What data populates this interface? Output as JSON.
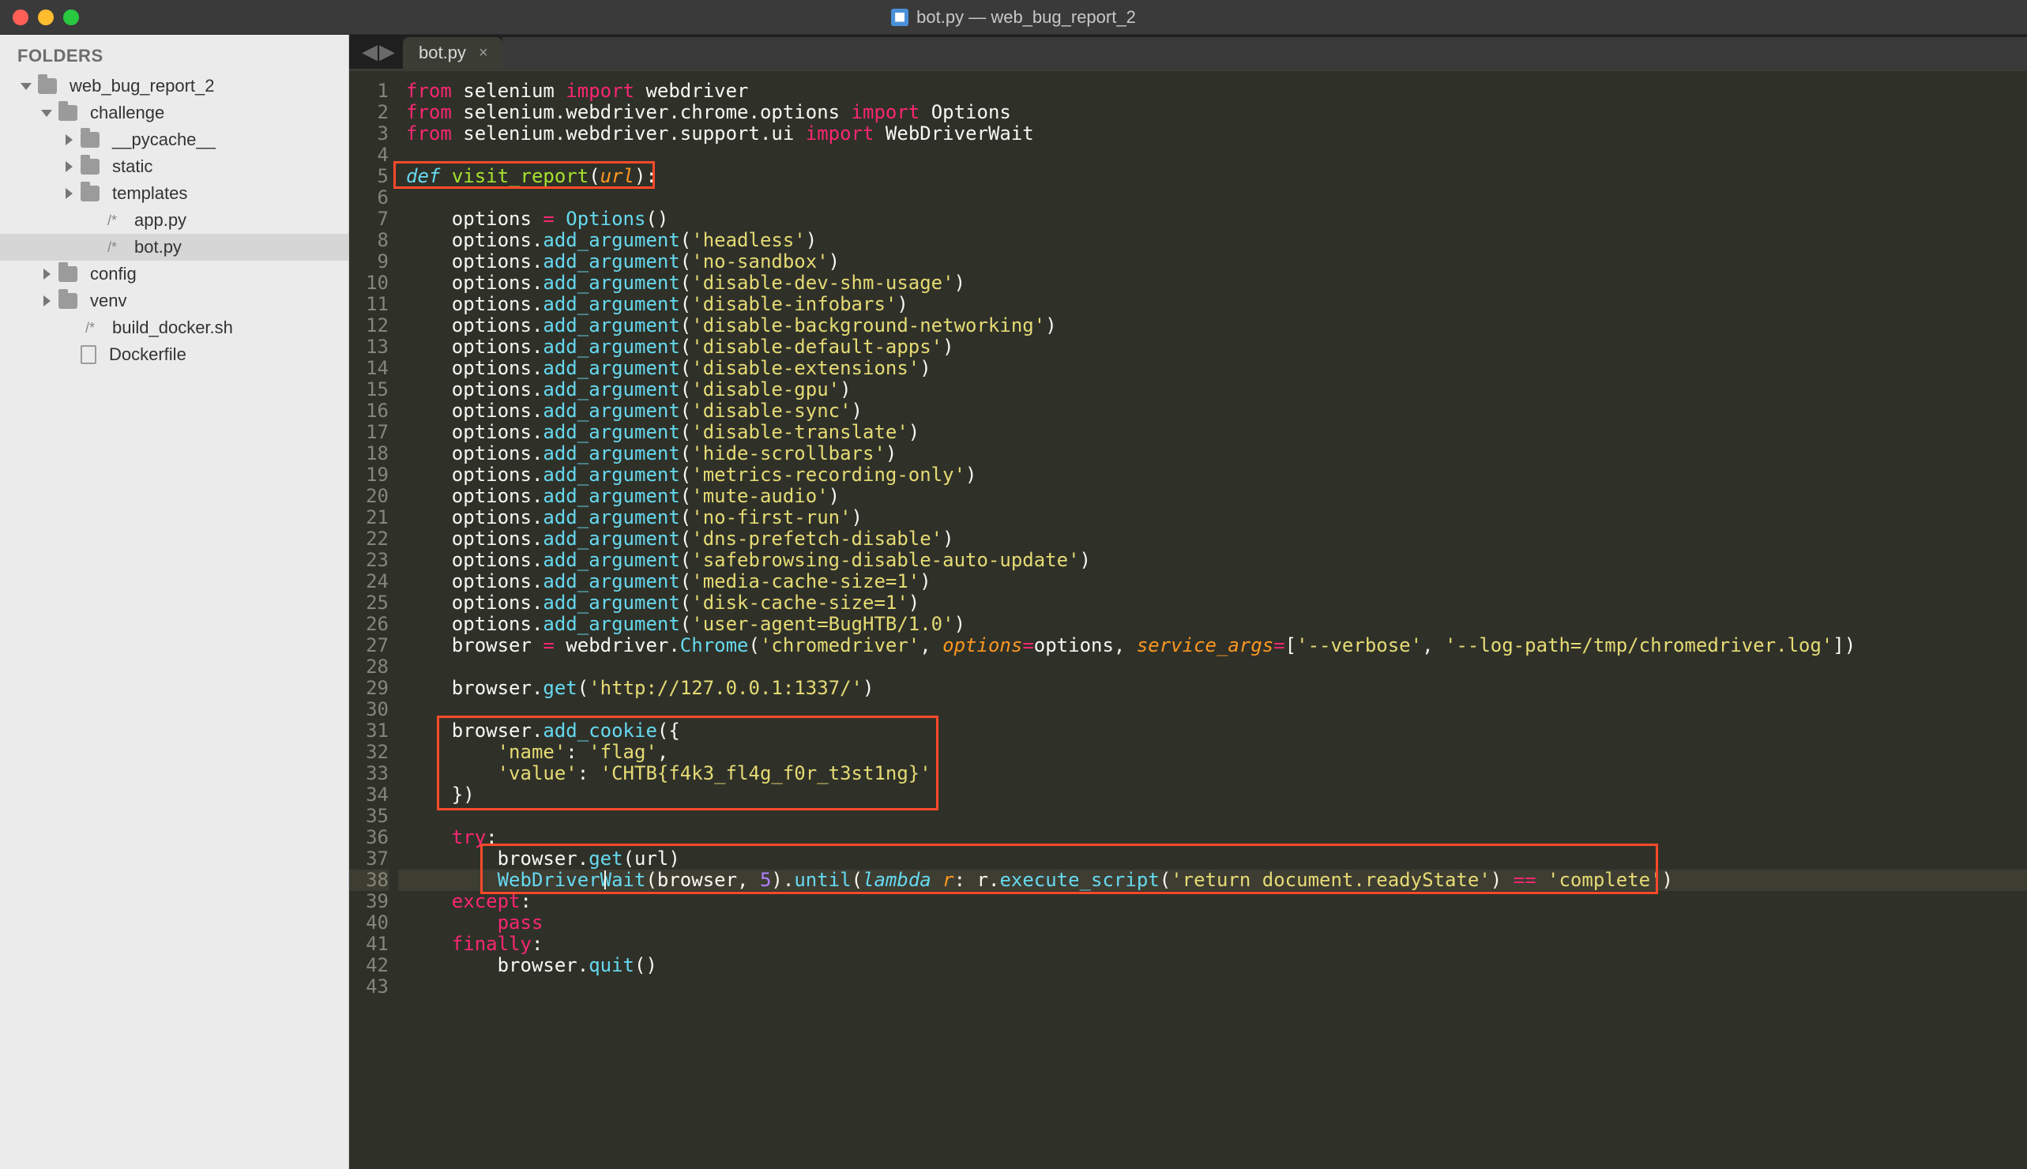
{
  "titlebar": {
    "title": "bot.py — web_bug_report_2"
  },
  "sidebar": {
    "header": "FOLDERS",
    "tree": [
      {
        "indent": 0,
        "arrow": "down",
        "icon": "folder",
        "label": "web_bug_report_2"
      },
      {
        "indent": 1,
        "arrow": "down",
        "icon": "folder",
        "label": "challenge"
      },
      {
        "indent": 2,
        "arrow": "right",
        "icon": "folder",
        "label": "__pycache__"
      },
      {
        "indent": 2,
        "arrow": "right",
        "icon": "folder",
        "label": "static"
      },
      {
        "indent": 2,
        "arrow": "right",
        "icon": "folder",
        "label": "templates"
      },
      {
        "indent": 3,
        "arrow": "",
        "icon": "text",
        "label": "app.py",
        "glyph": "/*"
      },
      {
        "indent": 3,
        "arrow": "",
        "icon": "text",
        "label": "bot.py",
        "glyph": "/*",
        "active": true
      },
      {
        "indent": 1,
        "arrow": "right",
        "icon": "folder",
        "label": "config"
      },
      {
        "indent": 1,
        "arrow": "right",
        "icon": "folder",
        "label": "venv"
      },
      {
        "indent": 2,
        "arrow": "",
        "icon": "text",
        "label": "build_docker.sh",
        "glyph": "/*"
      },
      {
        "indent": 2,
        "arrow": "",
        "icon": "file",
        "label": "Dockerfile"
      }
    ]
  },
  "tabs": {
    "active": {
      "label": "bot.py"
    }
  },
  "editor": {
    "filename": "bot.py",
    "cursor_line": 38,
    "highlight_boxes": [
      {
        "name": "def-visit-report",
        "lines": [
          5,
          5
        ]
      },
      {
        "name": "add-cookie",
        "lines": [
          31,
          34
        ]
      },
      {
        "name": "get-and-wait",
        "lines": [
          37,
          38
        ]
      }
    ],
    "lines": [
      {
        "n": 1,
        "t": [
          [
            "kw",
            "from"
          ],
          [
            "plain",
            " selenium "
          ],
          [
            "kw",
            "import"
          ],
          [
            "plain",
            " webdriver"
          ]
        ]
      },
      {
        "n": 2,
        "t": [
          [
            "kw",
            "from"
          ],
          [
            "plain",
            " selenium"
          ],
          [
            "punc",
            "."
          ],
          [
            "plain",
            "webdriver"
          ],
          [
            "punc",
            "."
          ],
          [
            "plain",
            "chrome"
          ],
          [
            "punc",
            "."
          ],
          [
            "plain",
            "options "
          ],
          [
            "kw",
            "import"
          ],
          [
            "plain",
            " Options"
          ]
        ]
      },
      {
        "n": 3,
        "t": [
          [
            "kw",
            "from"
          ],
          [
            "plain",
            " selenium"
          ],
          [
            "punc",
            "."
          ],
          [
            "plain",
            "webdriver"
          ],
          [
            "punc",
            "."
          ],
          [
            "plain",
            "support"
          ],
          [
            "punc",
            "."
          ],
          [
            "plain",
            "ui "
          ],
          [
            "kw",
            "import"
          ],
          [
            "plain",
            " WebDriverWait"
          ]
        ]
      },
      {
        "n": 4,
        "t": []
      },
      {
        "n": 5,
        "t": [
          [
            "kw2",
            "def"
          ],
          [
            "plain",
            " "
          ],
          [
            "name",
            "visit_report"
          ],
          [
            "punc",
            "("
          ],
          [
            "param",
            "url"
          ],
          [
            "punc",
            "):"
          ]
        ]
      },
      {
        "n": 6,
        "t": []
      },
      {
        "n": 7,
        "t": [
          [
            "plain",
            "    options "
          ],
          [
            "op",
            "="
          ],
          [
            "plain",
            " "
          ],
          [
            "fn",
            "Options"
          ],
          [
            "punc",
            "()"
          ]
        ]
      },
      {
        "n": 8,
        "t": [
          [
            "plain",
            "    options"
          ],
          [
            "punc",
            "."
          ],
          [
            "fn",
            "add_argument"
          ],
          [
            "punc",
            "("
          ],
          [
            "str",
            "'headless'"
          ],
          [
            "punc",
            ")"
          ]
        ]
      },
      {
        "n": 9,
        "t": [
          [
            "plain",
            "    options"
          ],
          [
            "punc",
            "."
          ],
          [
            "fn",
            "add_argument"
          ],
          [
            "punc",
            "("
          ],
          [
            "str",
            "'no-sandbox'"
          ],
          [
            "punc",
            ")"
          ]
        ]
      },
      {
        "n": 10,
        "t": [
          [
            "plain",
            "    options"
          ],
          [
            "punc",
            "."
          ],
          [
            "fn",
            "add_argument"
          ],
          [
            "punc",
            "("
          ],
          [
            "str",
            "'disable-dev-shm-usage'"
          ],
          [
            "punc",
            ")"
          ]
        ]
      },
      {
        "n": 11,
        "t": [
          [
            "plain",
            "    options"
          ],
          [
            "punc",
            "."
          ],
          [
            "fn",
            "add_argument"
          ],
          [
            "punc",
            "("
          ],
          [
            "str",
            "'disable-infobars'"
          ],
          [
            "punc",
            ")"
          ]
        ]
      },
      {
        "n": 12,
        "t": [
          [
            "plain",
            "    options"
          ],
          [
            "punc",
            "."
          ],
          [
            "fn",
            "add_argument"
          ],
          [
            "punc",
            "("
          ],
          [
            "str",
            "'disable-background-networking'"
          ],
          [
            "punc",
            ")"
          ]
        ]
      },
      {
        "n": 13,
        "t": [
          [
            "plain",
            "    options"
          ],
          [
            "punc",
            "."
          ],
          [
            "fn",
            "add_argument"
          ],
          [
            "punc",
            "("
          ],
          [
            "str",
            "'disable-default-apps'"
          ],
          [
            "punc",
            ")"
          ]
        ]
      },
      {
        "n": 14,
        "t": [
          [
            "plain",
            "    options"
          ],
          [
            "punc",
            "."
          ],
          [
            "fn",
            "add_argument"
          ],
          [
            "punc",
            "("
          ],
          [
            "str",
            "'disable-extensions'"
          ],
          [
            "punc",
            ")"
          ]
        ]
      },
      {
        "n": 15,
        "t": [
          [
            "plain",
            "    options"
          ],
          [
            "punc",
            "."
          ],
          [
            "fn",
            "add_argument"
          ],
          [
            "punc",
            "("
          ],
          [
            "str",
            "'disable-gpu'"
          ],
          [
            "punc",
            ")"
          ]
        ]
      },
      {
        "n": 16,
        "t": [
          [
            "plain",
            "    options"
          ],
          [
            "punc",
            "."
          ],
          [
            "fn",
            "add_argument"
          ],
          [
            "punc",
            "("
          ],
          [
            "str",
            "'disable-sync'"
          ],
          [
            "punc",
            ")"
          ]
        ]
      },
      {
        "n": 17,
        "t": [
          [
            "plain",
            "    options"
          ],
          [
            "punc",
            "."
          ],
          [
            "fn",
            "add_argument"
          ],
          [
            "punc",
            "("
          ],
          [
            "str",
            "'disable-translate'"
          ],
          [
            "punc",
            ")"
          ]
        ]
      },
      {
        "n": 18,
        "t": [
          [
            "plain",
            "    options"
          ],
          [
            "punc",
            "."
          ],
          [
            "fn",
            "add_argument"
          ],
          [
            "punc",
            "("
          ],
          [
            "str",
            "'hide-scrollbars'"
          ],
          [
            "punc",
            ")"
          ]
        ]
      },
      {
        "n": 19,
        "t": [
          [
            "plain",
            "    options"
          ],
          [
            "punc",
            "."
          ],
          [
            "fn",
            "add_argument"
          ],
          [
            "punc",
            "("
          ],
          [
            "str",
            "'metrics-recording-only'"
          ],
          [
            "punc",
            ")"
          ]
        ]
      },
      {
        "n": 20,
        "t": [
          [
            "plain",
            "    options"
          ],
          [
            "punc",
            "."
          ],
          [
            "fn",
            "add_argument"
          ],
          [
            "punc",
            "("
          ],
          [
            "str",
            "'mute-audio'"
          ],
          [
            "punc",
            ")"
          ]
        ]
      },
      {
        "n": 21,
        "t": [
          [
            "plain",
            "    options"
          ],
          [
            "punc",
            "."
          ],
          [
            "fn",
            "add_argument"
          ],
          [
            "punc",
            "("
          ],
          [
            "str",
            "'no-first-run'"
          ],
          [
            "punc",
            ")"
          ]
        ]
      },
      {
        "n": 22,
        "t": [
          [
            "plain",
            "    options"
          ],
          [
            "punc",
            "."
          ],
          [
            "fn",
            "add_argument"
          ],
          [
            "punc",
            "("
          ],
          [
            "str",
            "'dns-prefetch-disable'"
          ],
          [
            "punc",
            ")"
          ]
        ]
      },
      {
        "n": 23,
        "t": [
          [
            "plain",
            "    options"
          ],
          [
            "punc",
            "."
          ],
          [
            "fn",
            "add_argument"
          ],
          [
            "punc",
            "("
          ],
          [
            "str",
            "'safebrowsing-disable-auto-update'"
          ],
          [
            "punc",
            ")"
          ]
        ]
      },
      {
        "n": 24,
        "t": [
          [
            "plain",
            "    options"
          ],
          [
            "punc",
            "."
          ],
          [
            "fn",
            "add_argument"
          ],
          [
            "punc",
            "("
          ],
          [
            "str",
            "'media-cache-size=1'"
          ],
          [
            "punc",
            ")"
          ]
        ]
      },
      {
        "n": 25,
        "t": [
          [
            "plain",
            "    options"
          ],
          [
            "punc",
            "."
          ],
          [
            "fn",
            "add_argument"
          ],
          [
            "punc",
            "("
          ],
          [
            "str",
            "'disk-cache-size=1'"
          ],
          [
            "punc",
            ")"
          ]
        ]
      },
      {
        "n": 26,
        "t": [
          [
            "plain",
            "    options"
          ],
          [
            "punc",
            "."
          ],
          [
            "fn",
            "add_argument"
          ],
          [
            "punc",
            "("
          ],
          [
            "str",
            "'user-agent=BugHTB/1.0'"
          ],
          [
            "punc",
            ")"
          ]
        ]
      },
      {
        "n": 27,
        "t": [
          [
            "plain",
            "    browser "
          ],
          [
            "op",
            "="
          ],
          [
            "plain",
            " webdriver"
          ],
          [
            "punc",
            "."
          ],
          [
            "fn",
            "Chrome"
          ],
          [
            "punc",
            "("
          ],
          [
            "str",
            "'chromedriver'"
          ],
          [
            "punc",
            ", "
          ],
          [
            "param",
            "options"
          ],
          [
            "op",
            "="
          ],
          [
            "plain",
            "options"
          ],
          [
            "punc",
            ", "
          ],
          [
            "param",
            "service_args"
          ],
          [
            "op",
            "="
          ],
          [
            "punc",
            "["
          ],
          [
            "str",
            "'--verbose'"
          ],
          [
            "punc",
            ", "
          ],
          [
            "str",
            "'--log-path=/tmp/chromedriver.log'"
          ],
          [
            "punc",
            "])"
          ]
        ]
      },
      {
        "n": 28,
        "t": []
      },
      {
        "n": 29,
        "t": [
          [
            "plain",
            "    browser"
          ],
          [
            "punc",
            "."
          ],
          [
            "fn",
            "get"
          ],
          [
            "punc",
            "("
          ],
          [
            "str",
            "'http://127.0.0.1:1337/'"
          ],
          [
            "punc",
            ")"
          ]
        ]
      },
      {
        "n": 30,
        "t": []
      },
      {
        "n": 31,
        "t": [
          [
            "plain",
            "    browser"
          ],
          [
            "punc",
            "."
          ],
          [
            "fn",
            "add_cookie"
          ],
          [
            "punc",
            "({"
          ]
        ]
      },
      {
        "n": 32,
        "t": [
          [
            "plain",
            "        "
          ],
          [
            "str",
            "'name'"
          ],
          [
            "punc",
            ": "
          ],
          [
            "str",
            "'flag'"
          ],
          [
            "punc",
            ","
          ]
        ]
      },
      {
        "n": 33,
        "t": [
          [
            "plain",
            "        "
          ],
          [
            "str",
            "'value'"
          ],
          [
            "punc",
            ": "
          ],
          [
            "str",
            "'CHTB{f4k3_fl4g_f0r_t3st1ng}'"
          ]
        ]
      },
      {
        "n": 34,
        "t": [
          [
            "plain",
            "    "
          ],
          [
            "punc",
            "})"
          ]
        ]
      },
      {
        "n": 35,
        "t": []
      },
      {
        "n": 36,
        "t": [
          [
            "plain",
            "    "
          ],
          [
            "kw",
            "try"
          ],
          [
            "punc",
            ":"
          ]
        ]
      },
      {
        "n": 37,
        "t": [
          [
            "plain",
            "        browser"
          ],
          [
            "punc",
            "."
          ],
          [
            "fn",
            "get"
          ],
          [
            "punc",
            "("
          ],
          [
            "plain",
            "url"
          ],
          [
            "punc",
            ")"
          ]
        ]
      },
      {
        "n": 38,
        "t": [
          [
            "plain",
            "        "
          ],
          [
            "fn",
            "WebDriverWait"
          ],
          [
            "punc",
            "("
          ],
          [
            "plain",
            "browser"
          ],
          [
            "punc",
            ", "
          ],
          [
            "num",
            "5"
          ],
          [
            "punc",
            ")"
          ],
          [
            "punc",
            "."
          ],
          [
            "fn",
            "until"
          ],
          [
            "punc",
            "("
          ],
          [
            "kw2",
            "lambda"
          ],
          [
            "plain",
            " "
          ],
          [
            "param",
            "r"
          ],
          [
            "punc",
            ": "
          ],
          [
            "plain",
            "r"
          ],
          [
            "punc",
            "."
          ],
          [
            "fn",
            "execute_script"
          ],
          [
            "punc",
            "("
          ],
          [
            "str",
            "'return document.readyState'"
          ],
          [
            "punc",
            ") "
          ],
          [
            "op",
            "=="
          ],
          [
            "plain",
            " "
          ],
          [
            "str",
            "'complete'"
          ],
          [
            "punc",
            ")"
          ]
        ]
      },
      {
        "n": 39,
        "t": [
          [
            "plain",
            "    "
          ],
          [
            "kw",
            "except"
          ],
          [
            "punc",
            ":"
          ]
        ]
      },
      {
        "n": 40,
        "t": [
          [
            "plain",
            "        "
          ],
          [
            "kw",
            "pass"
          ]
        ]
      },
      {
        "n": 41,
        "t": [
          [
            "plain",
            "    "
          ],
          [
            "kw",
            "finally"
          ],
          [
            "punc",
            ":"
          ]
        ]
      },
      {
        "n": 42,
        "t": [
          [
            "plain",
            "        browser"
          ],
          [
            "punc",
            "."
          ],
          [
            "fn",
            "quit"
          ],
          [
            "punc",
            "()"
          ]
        ]
      },
      {
        "n": 43,
        "t": []
      }
    ]
  }
}
